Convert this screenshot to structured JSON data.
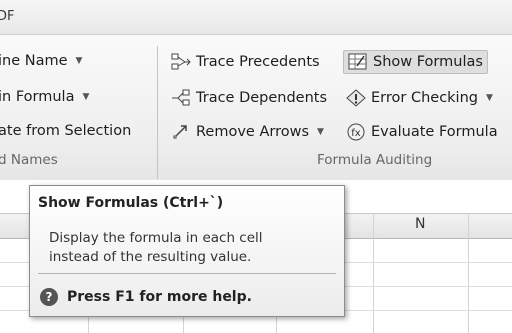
{
  "tab": {
    "text": "DF"
  },
  "define_names": {
    "define_name": "ine Name",
    "use_in_formula": "in Formula",
    "create_from_selection": "ate from Selection",
    "group_label": "d Names"
  },
  "formula_auditing": {
    "trace_precedents": "Trace Precedents",
    "trace_dependents": "Trace Dependents",
    "remove_arrows": "Remove Arrows",
    "show_formulas": "Show Formulas",
    "error_checking": "Error Checking",
    "evaluate_formula": "Evaluate Formula",
    "group_label": "Formula Auditing"
  },
  "sheet": {
    "column_n": "N"
  },
  "tooltip": {
    "title": "Show Formulas (Ctrl+`)",
    "line1": "Display the formula in each cell",
    "line2": "instead of the resulting value.",
    "help": "Press F1 for more help."
  },
  "icons": [
    "trace-precedents-icon",
    "trace-dependents-icon",
    "remove-arrows-icon",
    "show-formulas-icon",
    "error-checking-icon",
    "evaluate-formula-icon",
    "help-icon"
  ]
}
